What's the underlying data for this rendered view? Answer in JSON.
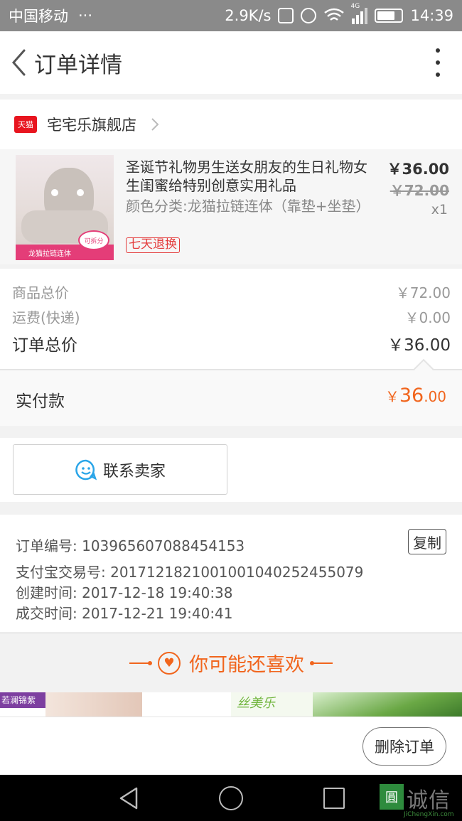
{
  "status_bar": {
    "carrier": "中国移动",
    "dots": "···",
    "net_speed": "2.9K/s",
    "network": "4G",
    "time": "14:39"
  },
  "header": {
    "title": "订单详情"
  },
  "store": {
    "badge": "天猫",
    "name": "宅宅乐旗舰店"
  },
  "product": {
    "title": "圣诞节礼物男生送女朋友的生日礼物女生闺蜜给特别创意实用礼品",
    "variant": "颜色分类:龙猫拉链连体（靠垫+坐垫）",
    "return_tag": "七天退换",
    "price": "￥36.00",
    "original_price": "￥72.00",
    "quantity": "x1",
    "image_band_text": "龙猫拉链连体",
    "image_badge_text": "可拆分"
  },
  "totals": {
    "goods_label": "商品总价",
    "goods_value": "￥72.00",
    "shipping_label": "运费(快递)",
    "shipping_value": "￥0.00",
    "order_total_label": "订单总价",
    "order_total_value": "￥36.00"
  },
  "paid": {
    "label": "实付款",
    "currency": "￥",
    "integer": "36",
    "decimal": ".00"
  },
  "contact": {
    "label": "联系卖家"
  },
  "order_info": {
    "order_no": "订单编号: 103965607088454153",
    "alipay_no": "支付宝交易号: 2017121821001001040252455079",
    "created": "创建时间: 2017-12-18 19:40:38",
    "completed": "成交时间: 2017-12-21 19:40:41",
    "copy_label": "复制"
  },
  "recommend": {
    "title": "你可能还喜欢"
  },
  "ad_strip": {
    "brand_1": "若澜锦紫",
    "brand_2": "丝美乐"
  },
  "footer": {
    "delete_label": "删除订单"
  },
  "watermark": {
    "logo_char": "圓",
    "text": "诚信",
    "sub": "JiChengXin.com"
  },
  "colors": {
    "accent_orange": "#f1651d",
    "tmall_red": "#e8151f",
    "return_red": "#e43d3d",
    "chat_blue": "#2aa5e8"
  }
}
